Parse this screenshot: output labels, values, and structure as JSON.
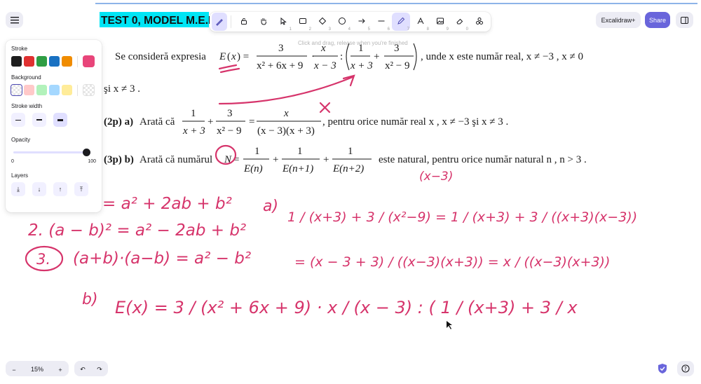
{
  "doc": {
    "title": "TEST 0, MODEL M.E.N",
    "question_line1": "Se consideră expresia",
    "question_tail": ", unde  x  este număr real,  x ≠ −3 ,  x ≠ 0",
    "question_line2": "şi  x ≠ 3 .",
    "part_a_label": "(2p) a)",
    "part_a_text": "Arată că",
    "part_a_tail": ", pentru orice număr real  x ,  x ≠ −3  şi  x ≠ 3 .",
    "part_b_label": "(3p) b)",
    "part_b_text": "Arată că numărul",
    "part_b_tail": "este natural, pentru orice număr natural  n ,  n > 3 ."
  },
  "hint": "Click and drag, release when you're finished",
  "toolbar": {
    "tools": [
      {
        "name": "lock-tool",
        "icon": "lock",
        "key": ""
      },
      {
        "name": "hand-tool",
        "icon": "hand",
        "key": ""
      },
      {
        "name": "selection-tool",
        "icon": "pointer",
        "key": "1"
      },
      {
        "name": "rectangle-tool",
        "icon": "rectangle",
        "key": "2"
      },
      {
        "name": "diamond-tool",
        "icon": "diamond",
        "key": "3"
      },
      {
        "name": "ellipse-tool",
        "icon": "ellipse",
        "key": "4"
      },
      {
        "name": "arrow-tool",
        "icon": "arrow",
        "key": "5"
      },
      {
        "name": "line-tool",
        "icon": "line",
        "key": "6"
      },
      {
        "name": "draw-tool",
        "icon": "pencil",
        "key": "7"
      },
      {
        "name": "text-tool",
        "icon": "text",
        "key": "8"
      },
      {
        "name": "image-tool",
        "icon": "image",
        "key": "9"
      },
      {
        "name": "eraser-tool",
        "icon": "eraser",
        "key": "0"
      },
      {
        "name": "more-tools",
        "icon": "shapes",
        "key": ""
      }
    ]
  },
  "header": {
    "excalidraw_plus": "Excalidraw+",
    "share": "Share"
  },
  "props": {
    "stroke_label": "Stroke",
    "stroke_colors": [
      "#1e1e1e",
      "#e03131",
      "#2f9e44",
      "#1971c2",
      "#f08c00"
    ],
    "stroke_selected": "#e8457a",
    "background_label": "Background",
    "background_colors": [
      "#ffc9c9",
      "#b2f2bb",
      "#a5d8ff",
      "#ffec99"
    ],
    "stroke_width_label": "Stroke width",
    "opacity_label": "Opacity",
    "opacity_min": "0",
    "opacity_max": "100",
    "opacity_value": 1.0,
    "layers_label": "Layers"
  },
  "zoom": {
    "level": "15%"
  },
  "colors": {
    "accent": "#6965db",
    "ink": "#d6346b",
    "title_bg": "#00e5f5"
  },
  "ink": {
    "identity_fragment": "= a² + 2ab + b²",
    "identity2": "2. (a − b)² = a² − 2ab + b²",
    "identity3": "(a+b)·(a−b) = a² − b²",
    "circle3": "3.",
    "a_label": "a)",
    "a_start": "1 / (x+3) + 3 / (x²−9) = 1 / (x+3) + 3 / ((x+3)(x−3))",
    "a_mid": "(x−3)",
    "a_result": "= (x − 3 + 3) / ((x−3)(x+3)) = x / ((x−3)(x+3))",
    "b_label": "b)",
    "b_start": "E(x) = 3 / (x² + 6x + 9) · x / (x − 3) : ( 1 / (x+3) + 3 / x"
  }
}
